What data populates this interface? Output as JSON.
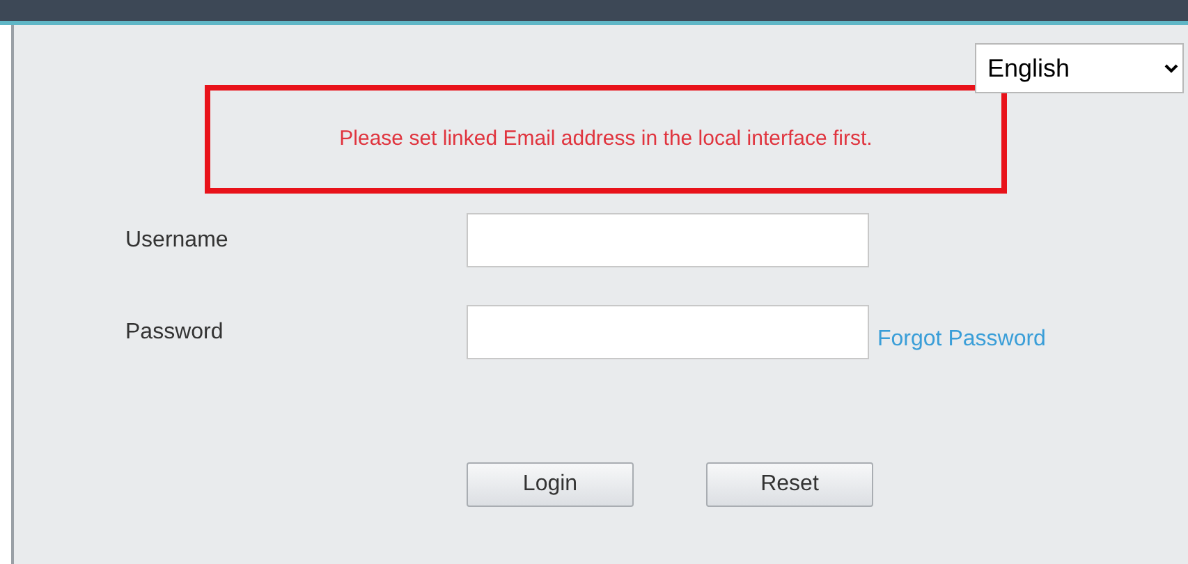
{
  "language_select": {
    "value": "English"
  },
  "notice": "Please set linked Email address in the local interface first.",
  "fields": [
    {
      "label": "Username"
    },
    {
      "label": "Password",
      "link": "Forgot Password"
    }
  ],
  "buttons": [
    "Login",
    "Reset"
  ]
}
